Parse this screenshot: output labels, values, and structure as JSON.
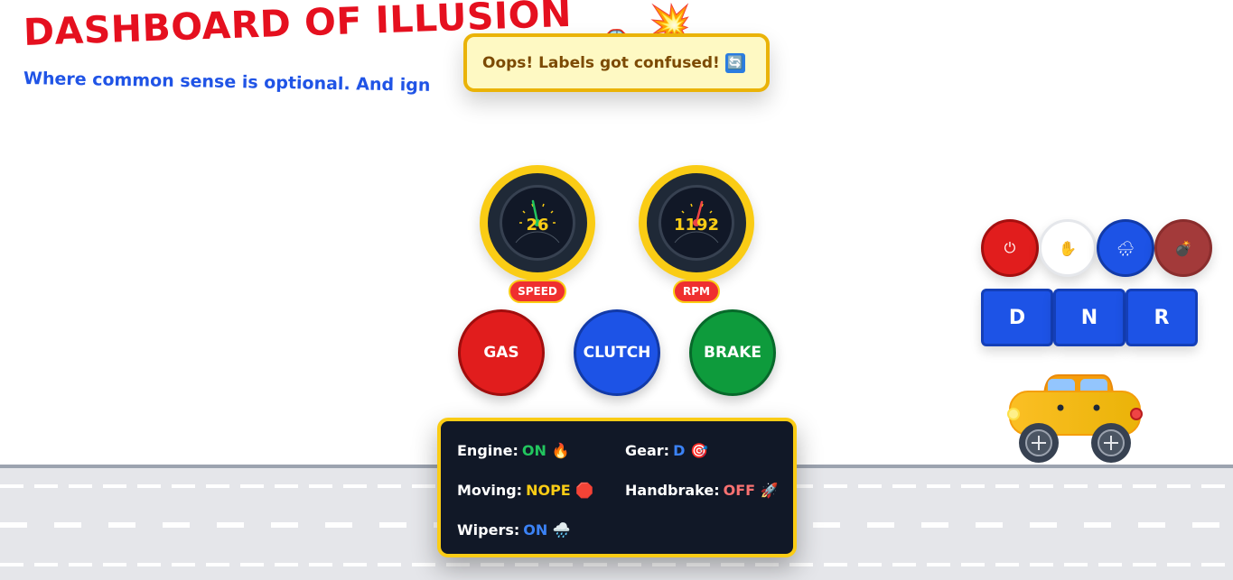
{
  "header": {
    "title": "DASHBOARD OF ILLUSION",
    "subtitle": "Where common sense is optional. And ign",
    "title_emojis": [
      "🚗",
      "💥"
    ]
  },
  "toast": {
    "message": "Oops! Labels got confused!",
    "icon": "🔄"
  },
  "gauges": [
    {
      "label": "SPEED",
      "value": "26",
      "needle_color": "#22c55e"
    },
    {
      "label": "RPM",
      "value": "1192",
      "needle_color": "#ef4444"
    }
  ],
  "pedals": {
    "gas": "GAS",
    "clutch": "CLUTCH",
    "brake": "BRAKE"
  },
  "status": {
    "engine": {
      "label": "Engine:",
      "value": "ON",
      "emoji": "🔥"
    },
    "gear": {
      "label": "Gear:",
      "value": "D",
      "emoji": "🎯"
    },
    "moving": {
      "label": "Moving:",
      "value": "NOPE",
      "emoji": "🛑"
    },
    "handbrake": {
      "label": "Handbrake:",
      "value": "OFF",
      "emoji": "🚀"
    },
    "wipers": {
      "label": "Wipers:",
      "value": "ON",
      "emoji": "🌧️"
    }
  },
  "controls": {
    "power_icon": "⏻",
    "hand_icon": "✋",
    "wiper_icon": "🌧",
    "bomb_icon": "💣"
  },
  "gears": [
    "D",
    "N",
    "R"
  ],
  "colors": {
    "accent_yellow": "#facc15",
    "red": "#e11d1d",
    "blue": "#1d53e6",
    "green": "#0e9b3c",
    "panel_dark": "#111827"
  }
}
